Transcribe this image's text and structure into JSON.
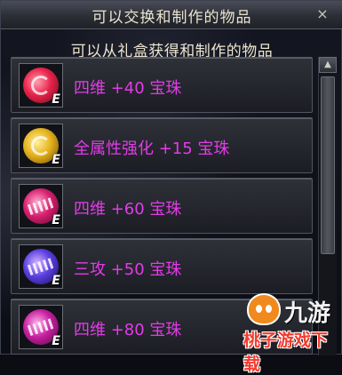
{
  "window": {
    "title": "可以交换和制作的物品",
    "close_icon": "×"
  },
  "subtitle": "可以从礼盒获得和制作的物品",
  "items": [
    {
      "label": "四维 +40 宝珠",
      "icon": "gem-swirl-icon",
      "badge": "E",
      "gem_color": "#e8234a"
    },
    {
      "label": "全属性强化 +15 宝珠",
      "icon": "gem-swirl-icon",
      "badge": "E",
      "gem_color": "#e6b21c"
    },
    {
      "label": "四维 +60 宝珠",
      "icon": "gem-hatch-icon",
      "badge": "E",
      "gem_color": "#d81f6f"
    },
    {
      "label": "三攻 +50 宝珠",
      "icon": "gem-hatch-icon",
      "badge": "E",
      "gem_color": "#5a3fe0"
    },
    {
      "label": "四维 +80 宝珠",
      "icon": "gem-hatch-icon",
      "badge": "E",
      "gem_color": "#c81ea0"
    }
  ],
  "watermark": {
    "logo": "九游",
    "site": "桃子游戏下载"
  },
  "colors": {
    "item_text": "#e23ce7",
    "title_text": "#e8e2cf"
  }
}
